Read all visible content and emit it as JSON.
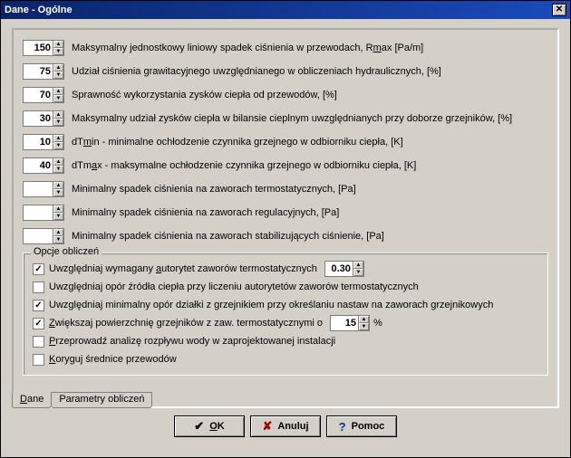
{
  "title": "Dane - Ogólne",
  "rows": [
    {
      "value": "150",
      "label_pre": "Maksymalny jednostkowy liniowy spadek ciśnienia w przewodach, R",
      "label_u": "m",
      "label_post": "ax [Pa/m]"
    },
    {
      "value": "75",
      "label_pre": "Udział ciśnienia grawitacyjnego uwzględnianego w obliczeniach hydraulicznych, [%]",
      "label_u": "",
      "label_post": ""
    },
    {
      "value": "70",
      "label_pre": "Sprawność wykorzystania  zysków ciepła od przewodów, [%]",
      "label_u": "",
      "label_post": ""
    },
    {
      "value": "30",
      "label_pre": "Maksymalny udział zysków ciepła w bilansie cieplnym uwzględnianych przy doborze grzejników, [%]",
      "label_u": "",
      "label_post": ""
    },
    {
      "value": "10",
      "label_pre": "dT",
      "label_u": "m",
      "label_post": "in - minimalne ochłodzenie czynnika grzejnego w odbiorniku ciepła, [K]"
    },
    {
      "value": "40",
      "label_pre": "dTm",
      "label_u": "a",
      "label_post": "x - maksymalne ochłodzenie czynnika grzejnego w odbiorniku ciepła, [K]"
    },
    {
      "value": "",
      "label_pre": "Minimalny spadek ciśnienia na zaworach termostatycznych, [Pa]",
      "label_u": "",
      "label_post": ""
    },
    {
      "value": "",
      "label_pre": "Minimalny spadek ciśnienia na zaworach regulacyjnych, [Pa]",
      "label_u": "",
      "label_post": ""
    },
    {
      "value": "",
      "label_pre": "Minimalny spadek ciśnienia na zaworach stabilizujących ciśnienie, [Pa]",
      "label_u": "",
      "label_post": ""
    }
  ],
  "group": {
    "title": "Opcje obliczeń",
    "opts": [
      {
        "checked": true,
        "pre": "Uwzględniaj wymagany ",
        "u": "a",
        "post": "utorytet zaworów termostatycznych",
        "spin": "0.30"
      },
      {
        "checked": false,
        "pre": "Uwzględniaj opór źródła ciepła przy liczeniu autorytetów zaworów termostatycznych",
        "u": "",
        "post": ""
      },
      {
        "checked": true,
        "pre": "Uwzględniaj minimalny opór działki z grzejnikiem  przy określaniu nastaw na zaworach grzejnikowych",
        "u": "",
        "post": ""
      },
      {
        "checked": true,
        "pre": "",
        "u": "Z",
        "post": "większaj powierzchnię grzejników z zaw. termostatycznymi o",
        "spin": "15",
        "suffix": "%"
      },
      {
        "checked": false,
        "pre": "",
        "u": "P",
        "post": "rzeprowadź analizę rozpływu wody w zaprojektowanej instalacji"
      },
      {
        "checked": false,
        "pre": "",
        "u": "K",
        "post": "oryguj średnice przewodów"
      }
    ]
  },
  "tabs": {
    "t1_u": "D",
    "t1_r": "ane",
    "t2": "Parametry obliczeń"
  },
  "buttons": {
    "ok_u": "O",
    "ok_r": "K",
    "cancel": "Anuluj",
    "help": "Pomoc"
  }
}
